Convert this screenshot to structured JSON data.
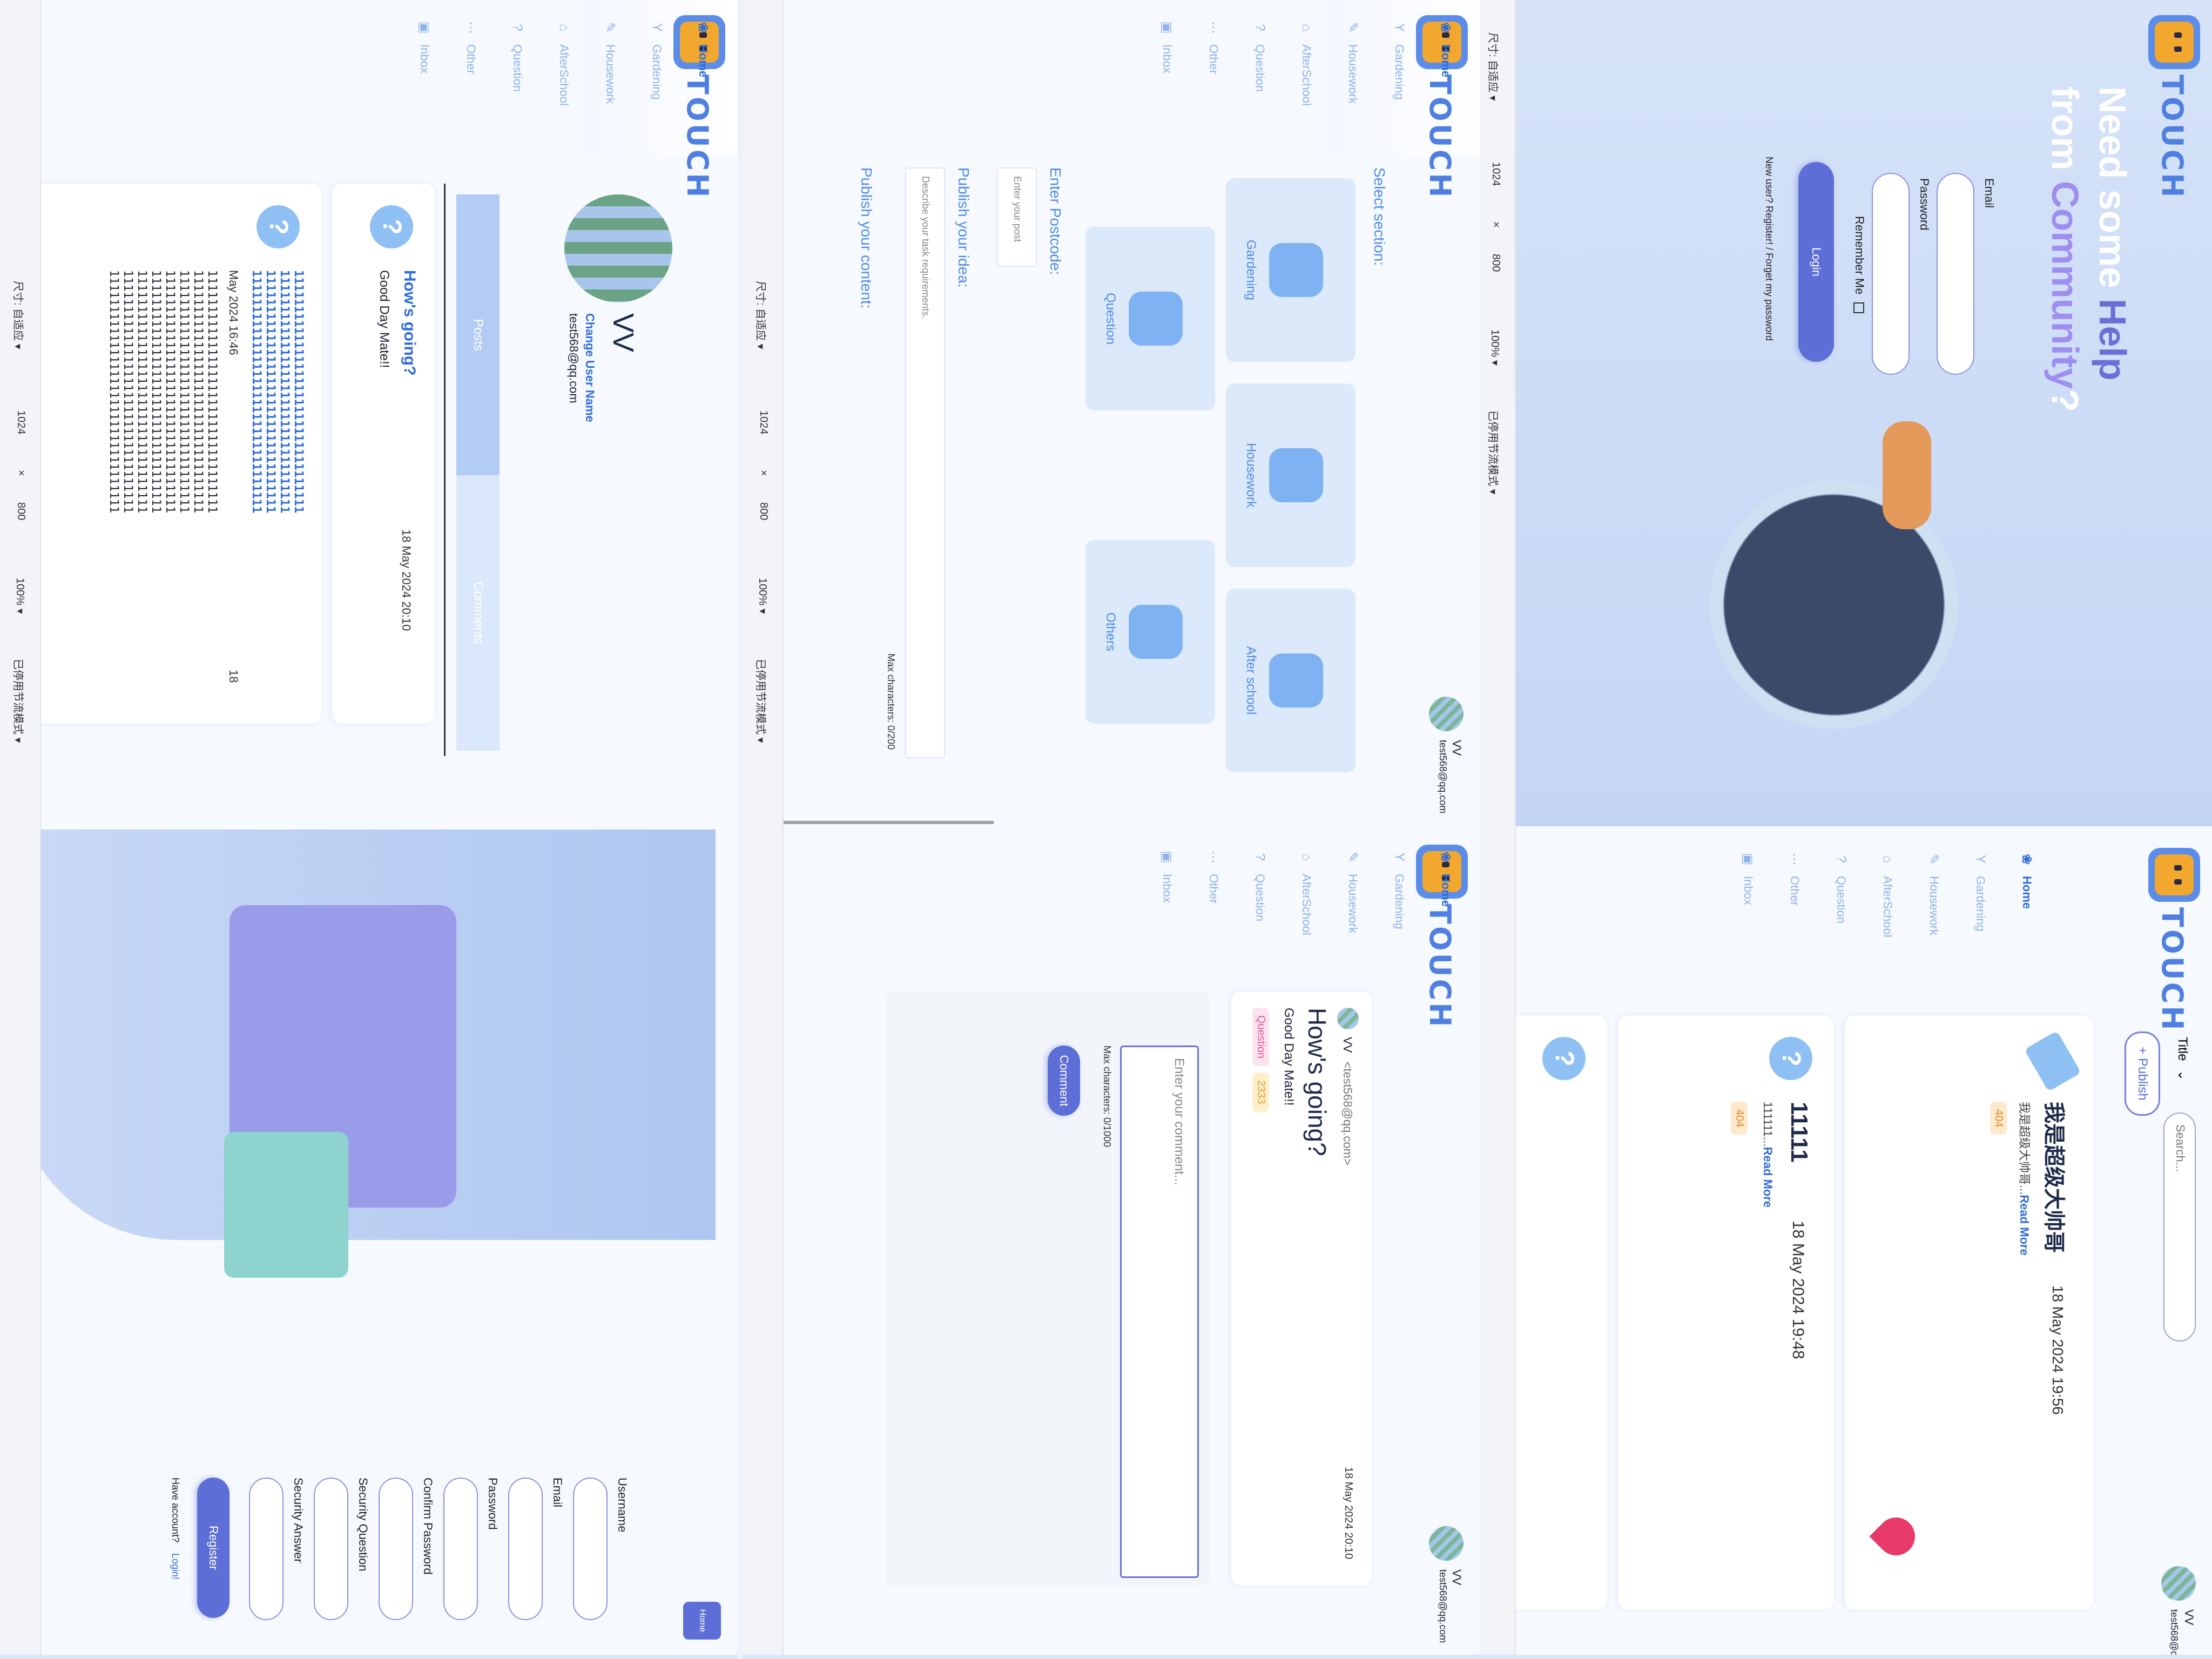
{
  "brand": {
    "name": "TOUCH"
  },
  "nav": {
    "items": [
      "Home",
      "Gardening",
      "Housework",
      "AfterSchool",
      "Question",
      "Other",
      "Inbox"
    ]
  },
  "status_bar": {
    "size_label": "尺寸: 自适应 ▾",
    "width": "1024",
    "x": "×",
    "height": "800",
    "zoom": "100% ▾",
    "throttle": "已停用节流模式 ▾"
  },
  "user": {
    "name": "VV",
    "email": "test568@qq.com",
    "email_bracketed": "<test568@qq.com>"
  },
  "login": {
    "headline_1": "Need some ",
    "headline_help": "Help",
    "headline_2": "from ",
    "headline_community": "Community",
    "headline_3": "?",
    "email_label": "Email",
    "password_label": "Password",
    "remember_label": "Remember Me",
    "login_button": "Login",
    "footer_links": "New user? Register! / Forget my password"
  },
  "feed": {
    "filter_value": "Title",
    "search_placeholder": "Search...",
    "publish_button": "+ Publish",
    "posts": [
      {
        "title": "我是超级大帅哥",
        "date": "18 May 2024 19:56",
        "excerpt": "我是超级大帅哥...",
        "read_more": "Read More",
        "tag": "404"
      },
      {
        "title": "11111",
        "date": "18 May 2024 19:48",
        "excerpt": "111111...",
        "read_more": "Read More",
        "tag": "404"
      }
    ]
  },
  "create": {
    "select_section": "Select section:",
    "sections": [
      "Gardening",
      "Housework",
      "After school",
      "Question",
      "Others"
    ],
    "postcode_label": "Enter Postcode:",
    "postcode_placeholder": "Enter your post",
    "idea_label": "Publish your idea:",
    "idea_placeholder": "Describe your task requirements.",
    "max_chars": "Max characters: 0/200",
    "content_label": "Publish your content:"
  },
  "detail": {
    "author": "VV",
    "title": "How's going?",
    "date": "18 May 2024 20:10",
    "body": "Good Day Mate!!",
    "tag_category": "Question",
    "tag_code": "2333",
    "comment_placeholder": "Enter your comment...",
    "comment_max": "Max characters: 0/1000",
    "comment_button": "Comment"
  },
  "profile": {
    "name": "VV",
    "change_name": "Change User Name",
    "email": "test568@qq.com",
    "tabs": [
      "Posts",
      "Comments"
    ],
    "post": {
      "title": "How's going?",
      "date": "18 May 2024 20:10",
      "body": "Good Day Mate!!"
    },
    "long_text_line": "1111111111111111111111111111111111",
    "long_text_date": "May 2024 16:46",
    "long_text_num": "18"
  },
  "register": {
    "home_button": "Home",
    "fields": [
      "Username",
      "Email",
      "Password",
      "Confirm Password",
      "Security Question",
      "Security Answer"
    ],
    "register_button": "Register",
    "have_account": "Have account?",
    "login_link": "Login!"
  }
}
